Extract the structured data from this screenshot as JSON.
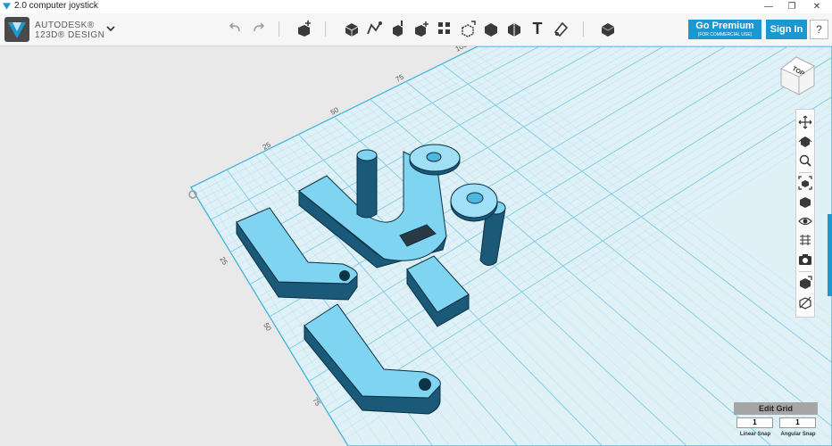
{
  "window": {
    "title": "2.0 computer joystick"
  },
  "brand": {
    "line1": "AUTODESK®",
    "line2": "123D® DESIGN"
  },
  "toolbar": {
    "go_premium": "Go Premium",
    "go_premium_sub": "(FOR COMMERCIAL USE)",
    "sign_in": "Sign In",
    "help": "?",
    "text_tool": "T"
  },
  "viewcube": {
    "label": "TOP"
  },
  "grid": {
    "rulers_top": [
      "25",
      "50",
      "75",
      "100"
    ],
    "rulers_left": [
      "25",
      "50",
      "75"
    ]
  },
  "snap": {
    "edit_grid": "Edit Grid",
    "linear_value": "1",
    "linear_label": "Linear Snap",
    "angular_value": "1",
    "angular_label": "Angular Snap"
  },
  "colors": {
    "accent": "#1d97cf",
    "grid_bg": "#dff1f7",
    "model": "#7fd4f2"
  }
}
